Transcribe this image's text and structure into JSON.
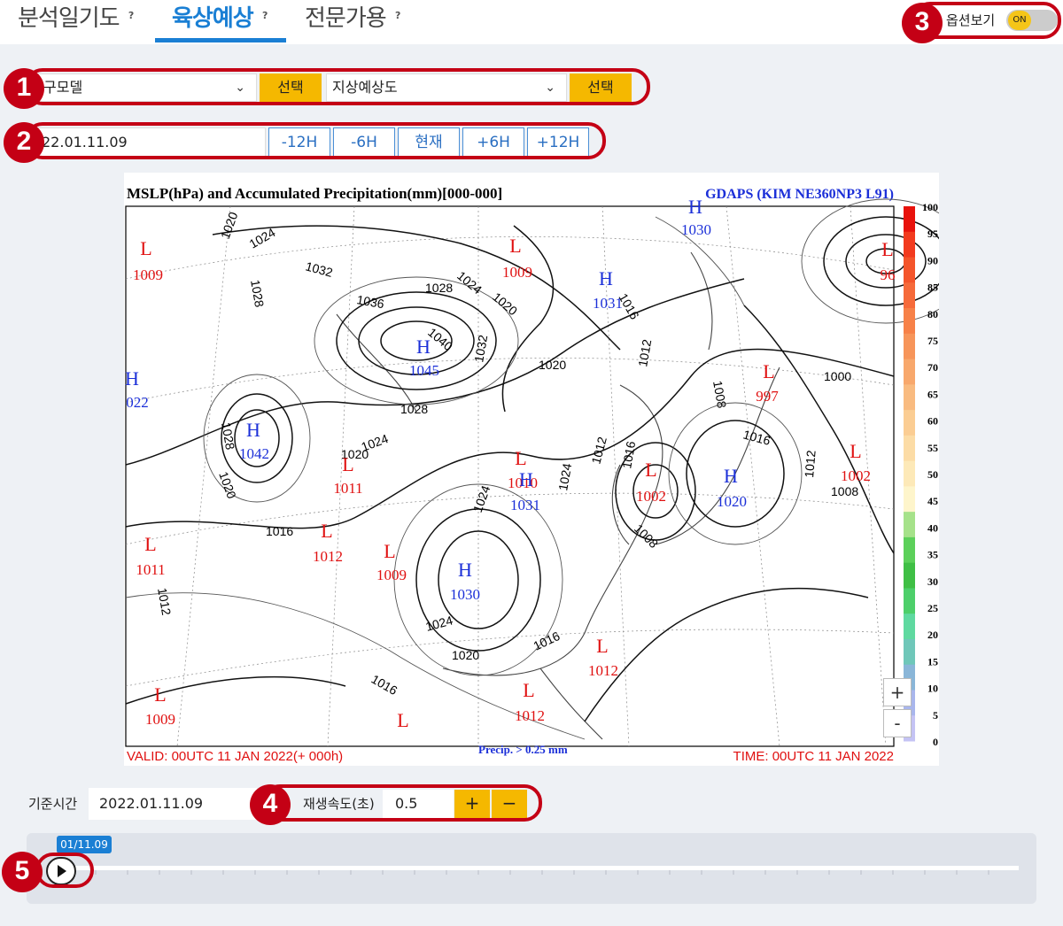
{
  "tabs": [
    {
      "label": "분석일기도",
      "help": "?"
    },
    {
      "label": "육상예상",
      "help": "?"
    },
    {
      "label": "전문가용",
      "help": "?"
    }
  ],
  "options": {
    "label": "옵션보기",
    "toggle": "ON"
  },
  "markers": [
    "1",
    "2",
    "3",
    "4",
    "5"
  ],
  "model_select": {
    "value": "구모델",
    "button": "선택"
  },
  "chart_select": {
    "value": "지상예상도",
    "button": "선택"
  },
  "date_input": "22.01.11.09",
  "time_buttons": [
    "-12H",
    "-6H",
    "현재",
    "+6H",
    "+12H"
  ],
  "map": {
    "title": "MSLP(hPa) and Accumulated Precipitation(mm)[000-000]",
    "model": "GDAPS (KIM NE360NP3 L91)",
    "valid": "VALID: 00UTC 11 JAN 2022(+ 000h)",
    "time": "TIME: 00UTC 11 JAN 2022",
    "precip": "Precip. > 0.25 mm",
    "scale_labels": [
      "100",
      "95",
      "90",
      "85",
      "80",
      "75",
      "70",
      "65",
      "60",
      "55",
      "50",
      "45",
      "40",
      "35",
      "30",
      "25",
      "20",
      "15",
      "10",
      "5",
      "0"
    ],
    "scale_colors": [
      "#e8120c",
      "#f23a1e",
      "#f4552b",
      "#f66a3a",
      "#f78148",
      "#f7955a",
      "#f8a86c",
      "#f9bb80",
      "#fbcd93",
      "#fcdca6",
      "#fde9b8",
      "#fef5cb",
      "#a6e28a",
      "#5cd05a",
      "#3fbf45",
      "#4dcf6a",
      "#5fd9a0",
      "#6fc7b9",
      "#8ab6d8",
      "#a9b6ec",
      "#c4c3f4"
    ],
    "pressure_labels": [
      {
        "type": "L",
        "value": "1009",
        "color": "#e01010"
      },
      {
        "type": "L",
        "value": "1009",
        "color": "#e01010"
      },
      {
        "type": "H",
        "value": "1031",
        "color": "#1b2fd8"
      },
      {
        "type": "H",
        "value": "1030",
        "color": "#1b2fd8"
      },
      {
        "type": "L",
        "value": "96",
        "color": "#e01010"
      },
      {
        "type": "H",
        "value": "1045",
        "color": "#1b2fd8"
      },
      {
        "type": "H",
        "value": "022",
        "color": "#1b2fd8"
      },
      {
        "type": "L",
        "value": "997",
        "color": "#e01010"
      },
      {
        "type": "H",
        "value": "1042",
        "color": "#1b2fd8"
      },
      {
        "type": "L",
        "value": "1011",
        "color": "#e01010"
      },
      {
        "type": "L",
        "value": "1010",
        "color": "#e01010"
      },
      {
        "type": "H",
        "value": "1031",
        "color": "#1b2fd8"
      },
      {
        "type": "L",
        "value": "1002",
        "color": "#e01010"
      },
      {
        "type": "H",
        "value": "1020",
        "color": "#1b2fd8"
      },
      {
        "type": "L",
        "value": "1002",
        "color": "#e01010"
      },
      {
        "type": "L",
        "value": "1011",
        "color": "#e01010"
      },
      {
        "type": "L",
        "value": "1012",
        "color": "#e01010"
      },
      {
        "type": "L",
        "value": "1009",
        "color": "#e01010"
      },
      {
        "type": "H",
        "value": "1030",
        "color": "#1b2fd8"
      },
      {
        "type": "L",
        "value": "1012",
        "color": "#e01010"
      },
      {
        "type": "L",
        "value": "1009",
        "color": "#e01010"
      },
      {
        "type": "L",
        "value": "1012",
        "color": "#e01010"
      },
      {
        "type": "L",
        "value": "",
        "color": "#e01010"
      }
    ],
    "isobar_labels": [
      "1020",
      "1024",
      "1032",
      "1028",
      "1036",
      "1040",
      "1028",
      "1024",
      "1020",
      "1020",
      "1028",
      "1024",
      "1020",
      "1016",
      "1012",
      "1008",
      "1000",
      "1016",
      "1012",
      "1008",
      "1016",
      "1012",
      "1024",
      "1020",
      "1016",
      "1016",
      "1012",
      "1024",
      "1020",
      "1028",
      "1024",
      "1016",
      "1008",
      "1032"
    ]
  },
  "zoom": {
    "in": "+",
    "out": "-"
  },
  "base_time": {
    "label": "기준시간",
    "value": "2022.01.11.09"
  },
  "speed": {
    "label": "재생속도(초)",
    "value": "0.5",
    "plus": "+",
    "minus": "−"
  },
  "timeline": {
    "tip": "01/11.09"
  }
}
